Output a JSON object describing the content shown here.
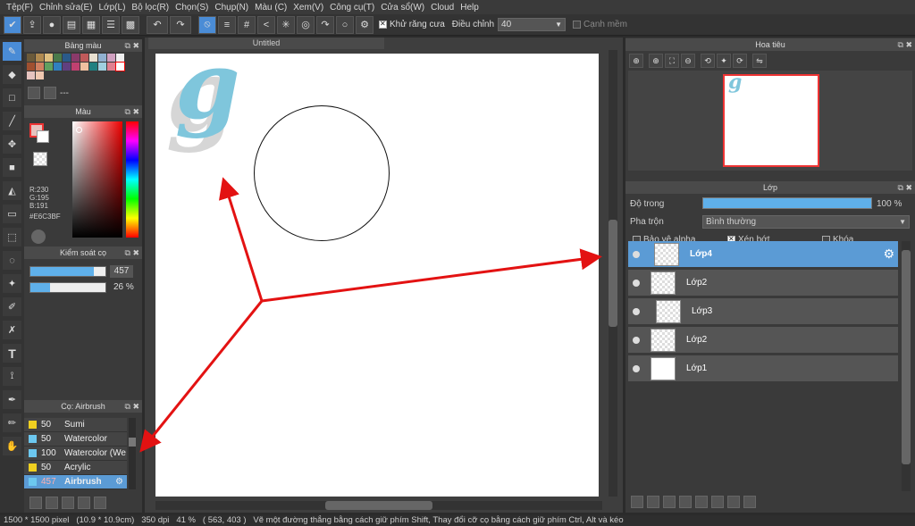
{
  "menu": [
    "Tệp(F)",
    "Chỉnh sửa(E)",
    "Lớp(L)",
    "Bộ lọc(R)",
    "Chọn(S)",
    "Chụp(N)",
    "Màu (C)",
    "Xem(V)",
    "Công cụ(T)",
    "Cửa sổ(W)",
    "Cloud",
    "Help"
  ],
  "toolbar": {
    "antialias_label": "Khử răng cưa",
    "adjust_label": "Điều chỉnh",
    "adjust_value": "40",
    "smooth_label": "Cạnh mềm",
    "icons": [
      "save-icon",
      "export-icon",
      "chat-icon",
      "comment-icon",
      "document-icon",
      "list-icon",
      "grid-icon",
      "undo-icon",
      "redo-icon",
      "snap-off-icon",
      "parallel-icon",
      "grid-snap-icon",
      "perspective-icon",
      "radial-icon",
      "concentric-icon",
      "curve-icon",
      "circle-snap-icon",
      "settings-icon"
    ]
  },
  "panels": {
    "palette_title": "Bảng màu",
    "palette_footer": "---",
    "color_title": "Màu",
    "color_readout": {
      "r": "R:230",
      "g": "G:195",
      "b": "B:191",
      "hex": "#E6C3BF"
    },
    "brush_control_title": "Kiểm soát cọ",
    "brush_size": "457",
    "brush_opacity": "26 %",
    "brush_size_fraction": 0.85,
    "brush_opacity_fraction": 0.26,
    "brush_list_title": "Cọ: Airbrush",
    "brushes": [
      {
        "size": "50",
        "name": "Sumi",
        "color": "#f0d020"
      },
      {
        "size": "50",
        "name": "Watercolor",
        "color": "#6cc8f0"
      },
      {
        "size": "100",
        "name": "Watercolor (We",
        "color": "#6cc8f0"
      },
      {
        "size": "50",
        "name": "Acrylic",
        "color": "#f0d020"
      },
      {
        "size": "457",
        "name": "Airbrush",
        "color": "#6cc8f0"
      }
    ]
  },
  "canvas": {
    "tab_title": "Untitled",
    "logo_letter": "g"
  },
  "navigator": {
    "title": "Hoa tiêu"
  },
  "layers": {
    "title": "Lớp",
    "opacity_label": "Độ trong",
    "opacity_value": "100 %",
    "blend_label": "Pha trộn",
    "blend_value": "Bình thường",
    "protect_alpha": "Bảo vệ alpha",
    "clipping": "Xén bớt",
    "lock": "Khóa",
    "items": [
      {
        "name": "Lớp4",
        "selected": true
      },
      {
        "name": "Lớp2",
        "selected": false
      },
      {
        "name": "Lớp3",
        "selected": false
      },
      {
        "name": "Lớp2",
        "selected": false
      },
      {
        "name": "Lớp1",
        "selected": false
      }
    ]
  },
  "status": {
    "size": "1500 * 1500 pixel",
    "cm": "(10.9 * 10.9cm)",
    "dpi": "350 dpi",
    "zoom": "41 %",
    "coords": "( 563, 403 )",
    "hint": "Vẽ một đường thẳng bằng cách giữ phím Shift, Thay đổi cỡ cọ bằng cách giữ phím Ctrl, Alt và kéo"
  },
  "colors": {
    "accent": "#4a8cd6",
    "selected_layer": "#5b9bd5",
    "annotation": "#e31212",
    "foreground": "#E6C3BF"
  }
}
